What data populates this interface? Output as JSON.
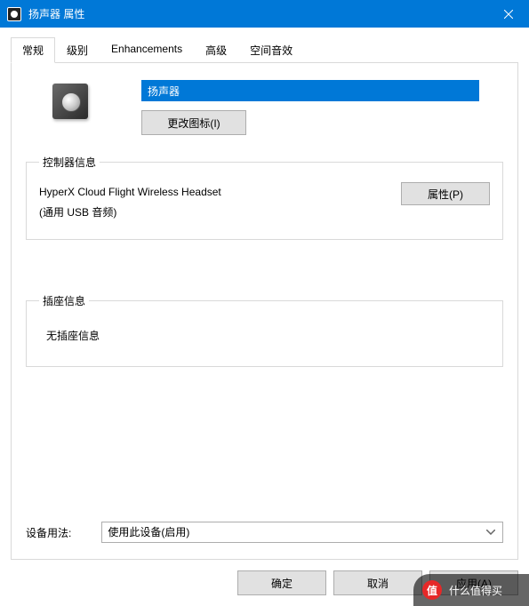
{
  "titlebar": {
    "title": "扬声器 属性"
  },
  "tabs": [
    {
      "label": "常规",
      "active": true
    },
    {
      "label": "级别",
      "active": false
    },
    {
      "label": "Enhancements",
      "active": false
    },
    {
      "label": "高级",
      "active": false
    },
    {
      "label": "空间音效",
      "active": false
    }
  ],
  "device": {
    "name_value": "扬声器",
    "change_icon_label": "更改图标(I)"
  },
  "controller": {
    "legend": "控制器信息",
    "name": "HyperX Cloud Flight Wireless Headset",
    "type": "(通用 USB 音频)",
    "properties_label": "属性(P)"
  },
  "jack": {
    "legend": "插座信息",
    "text": "无插座信息"
  },
  "usage": {
    "label": "设备用法:",
    "selected": "使用此设备(启用)"
  },
  "buttons": {
    "ok": "确定",
    "cancel": "取消",
    "apply": "应用(A)"
  },
  "watermark": {
    "badge": "值",
    "text": "什么值得买"
  }
}
